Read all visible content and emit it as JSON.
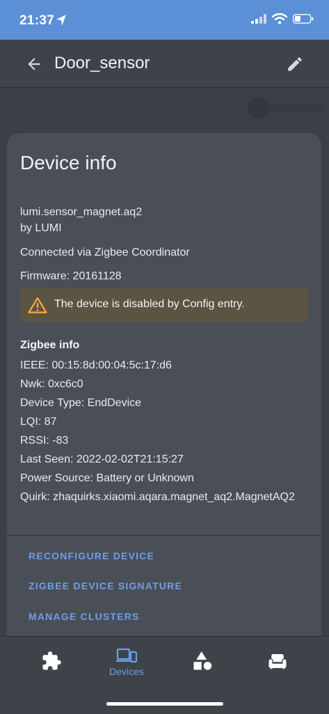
{
  "status_bar": {
    "time": "21:37"
  },
  "app_bar": {
    "title": "Door_sensor"
  },
  "card": {
    "title": "Device info",
    "model": "lumi.sensor_magnet.aq2",
    "manufacturer": "by LUMI",
    "connected_via": "Connected via Zigbee Coordinator",
    "firmware": "Firmware: 20161128",
    "warning": "The device is disabled by Config entry."
  },
  "zigbee": {
    "heading": "Zigbee info",
    "ieee": "IEEE: 00:15:8d:00:04:5c:17:d6",
    "nwk": "Nwk: 0xc6c0",
    "device_type": "Device Type: EndDevice",
    "lqi": "LQI: 87",
    "rssi": "RSSI: -83",
    "last_seen": "Last Seen: 2022-02-02T21:15:27",
    "power_source": "Power Source: Battery or Unknown",
    "quirk": "Quirk: zhaquirks.xiaomi.aqara.magnet_aq2.MagnetAQ2"
  },
  "actions": {
    "reconfigure": "RECONFIGURE DEVICE",
    "signature": "ZIGBEE DEVICE SIGNATURE",
    "clusters": "MANAGE CLUSTERS"
  },
  "bottom_nav": {
    "items": [
      {
        "icon": "puzzle-icon"
      },
      {
        "icon": "devices-icon",
        "label": "Devices",
        "active": true
      },
      {
        "icon": "shapes-icon"
      },
      {
        "icon": "sofa-icon"
      }
    ]
  },
  "colors": {
    "status_bar": "#5b8fd6",
    "background": "#3b3f46",
    "card": "#4a4f57",
    "accent": "#6f9ee6",
    "warning_bg": "#5b5443",
    "warning_icon": "#f0a73a"
  }
}
